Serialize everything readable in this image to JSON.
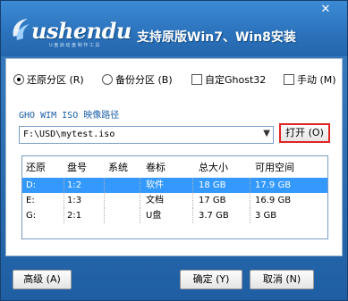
{
  "window": {
    "title": "支持原版Win7、Win8安装",
    "close_glyph": "✕"
  },
  "logo": {
    "text": "ushendu",
    "subtitle": "U 盘 启 动 盘 制 作 工 具"
  },
  "options": {
    "restore": {
      "label": "还原分区 (R)",
      "checked": true
    },
    "backup": {
      "label": "备份分区 (B)",
      "checked": false
    },
    "ghost": {
      "label": "自定Ghost32",
      "checked": false
    },
    "manual": {
      "label": "手动 (M)",
      "checked": false
    }
  },
  "path": {
    "label": "GHO WIM ISO 映像路径",
    "value": "F:\\USD\\mytest.iso",
    "open_label": "打开 (O)"
  },
  "table": {
    "columns": [
      "还原",
      "盘号",
      "系统",
      "卷标",
      "总大小",
      "可用空间"
    ],
    "rows": [
      {
        "restore": "D:",
        "disk": "1:2",
        "system": "",
        "volume": "软件",
        "total": "18 GB",
        "free": "17.9 GB",
        "selected": true
      },
      {
        "restore": "E:",
        "disk": "1:3",
        "system": "",
        "volume": "文档",
        "total": "17 GB",
        "free": "16.9 GB",
        "selected": false
      },
      {
        "restore": "G:",
        "disk": "2:1",
        "system": "",
        "volume": "U盘",
        "total": "3.7 GB",
        "free": "3 GB",
        "selected": false
      }
    ]
  },
  "buttons": {
    "advanced": "高级 (A)",
    "ok": "确定 (Y)",
    "cancel": "取消 (N)"
  },
  "colors": {
    "accent": "#2b72bb",
    "selection": "#3399ff",
    "highlight_border": "#e02424"
  }
}
